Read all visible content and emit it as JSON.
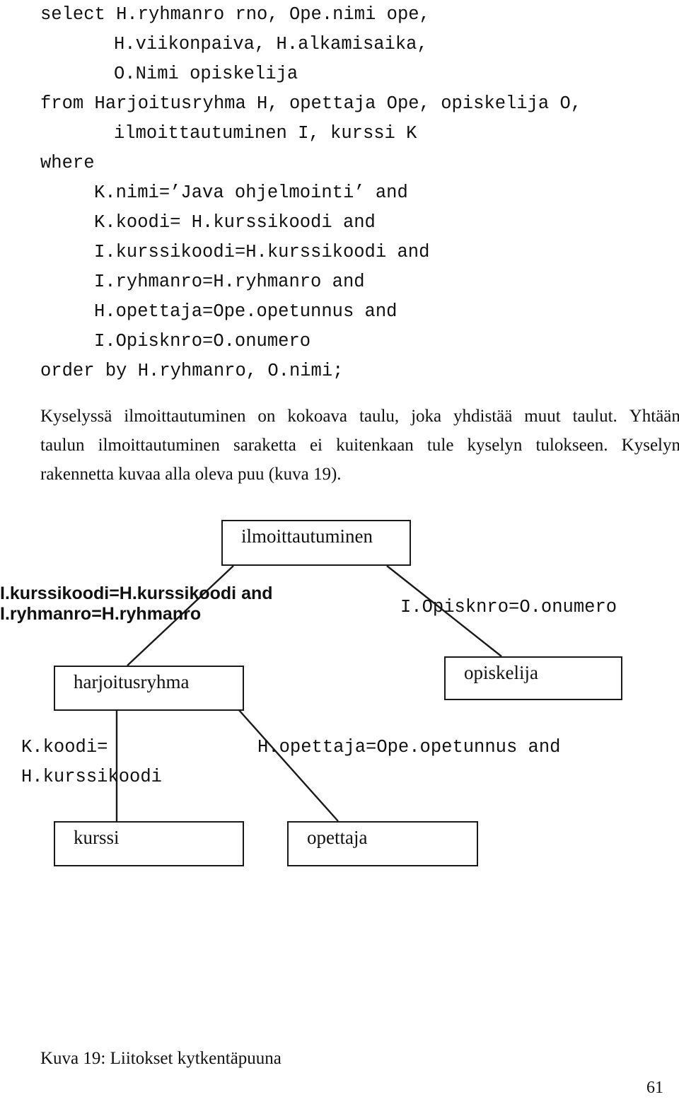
{
  "document": {
    "page_number": "61",
    "caption": "Kuva 19: Liitokset kytkentäpuuna"
  },
  "sql": {
    "lines": [
      {
        "indent": 0,
        "text": "select H.ryhmanro rno, Ope.nimi ope,"
      },
      {
        "indent": 5,
        "text": "H.viikonpaiva, H.alkamisaika,"
      },
      {
        "indent": 5,
        "text": "O.Nimi opiskelija"
      },
      {
        "indent": 0,
        "text": "from Harjoitusryhma H, opettaja Ope, opiskelija O,"
      },
      {
        "indent": 5,
        "text": "ilmoittautuminen I, kurssi K"
      },
      {
        "indent": 0,
        "text": "where"
      },
      {
        "indent": 4,
        "text": "K.nimi=’Java ohjelmointi’ and"
      },
      {
        "indent": 4,
        "text": "K.koodi= H.kurssikoodi and"
      },
      {
        "indent": 4,
        "text": "I.kurssikoodi=H.kurssikoodi and"
      },
      {
        "indent": 4,
        "text": "I.ryhmanro=H.ryhmanro and"
      },
      {
        "indent": 4,
        "text": "H.opettaja=Ope.opetunnus and"
      },
      {
        "indent": 4,
        "text": "I.Opisknro=O.onumero"
      },
      {
        "indent": 0,
        "text": "order by H.ryhmanro, O.nimi;"
      }
    ]
  },
  "paragraph": {
    "line1_words": [
      "Kyselyssä",
      "ilmoittautuminen",
      "on",
      "kokoava",
      "taulu,",
      "joka",
      "yhdistää",
      "muut",
      "taulut.",
      "Yhtään"
    ],
    "line2_words": [
      "taulun",
      "ilmoittautuminen",
      "saraketta",
      "ei",
      "kuitenkaan",
      "tule",
      "kyselyn",
      "tulokseen.",
      "Kyselyn"
    ],
    "line3": "rakennetta kuvaa alla oleva puu (kuva 19)."
  },
  "tree": {
    "nodes": {
      "root": "ilmoittautuminen",
      "harjoitusryhma": "harjoitusryhma",
      "opiskelija": "opiskelija",
      "kurssi": "kurssi",
      "opettaja": "opettaja"
    },
    "edge_labels": {
      "root_to_harjoitusryhma_line1": "I.kurssikoodi=H.kurssikoodi and",
      "root_to_harjoitusryhma_line2": "I.ryhmanro=H.ryhmanro",
      "root_to_opiskelija": "I.Opisknro=O.onumero",
      "harjoitusryhma_to_kurssi_line1": "K.koodi=",
      "harjoitusryhma_to_kurssi_line2": "H.kurssikoodi",
      "harjoitusryhma_to_opettaja": "H.opettaja=Ope.opetunnus and"
    }
  },
  "colors": {
    "text": "#111111",
    "stroke": "#1a1a1a",
    "background": "#ffffff"
  }
}
